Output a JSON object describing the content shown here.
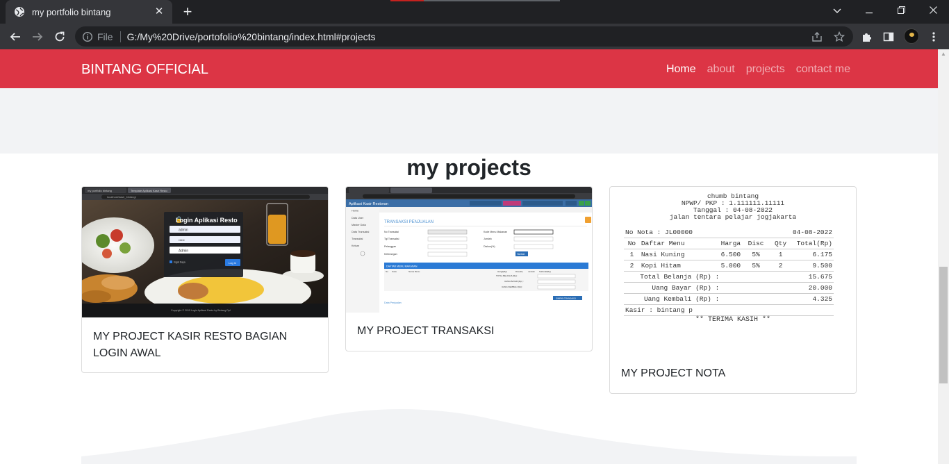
{
  "browser": {
    "tab_title": "my portfolio bintang",
    "omnibox_scheme": "File",
    "omnibox_url": "G:/My%20Drive/portofolio%20bintang/index.html#projects"
  },
  "navbar": {
    "brand": "BINTANG OFFICIAL",
    "links": [
      {
        "label": "Home",
        "active": true
      },
      {
        "label": "about",
        "active": false
      },
      {
        "label": "projects",
        "active": false
      },
      {
        "label": "contact me",
        "active": false
      }
    ],
    "color": "#dc3545"
  },
  "projects": {
    "title": "my projects",
    "cards": [
      {
        "caption": "MY PROJECT KASIR RESTO BAGIAN LOGIN AWAL"
      },
      {
        "caption": "MY PROJECT TRANSAKSI"
      },
      {
        "caption": "MY PROJECT NOTA"
      }
    ]
  },
  "login_screenshot": {
    "tab1": "my portfolio bintang",
    "tab2": "Template Aplikasi Kasir Resto",
    "url": "localhost/kasir_bintang/",
    "heading": "Login Aplikasi Resto",
    "username": "admin",
    "password": "•••••",
    "role": "Admin",
    "remember": "Ingat Saya",
    "login_button": "Log In",
    "footer": "Copyright © 2015 Login Aplikasi Resto by Bintang Dpl"
  },
  "transaction_screenshot": {
    "app_title": "Aplikasi Kasir Restoran",
    "page_heading": "TRANSAKSI PENJUALAN",
    "menu": [
      "Home",
      "Data User",
      "Master Data",
      "Data Transaksi",
      "Transaksi",
      "Keluar"
    ],
    "form_left": [
      "No Transaksi",
      "Tgl Transaksi",
      "Pelanggan",
      "Keterangan"
    ],
    "form_right": [
      "Kode Menu Makanan",
      "Jumlah",
      "Diskon(%)"
    ],
    "table_bar": "DAFTAR MENU MAKANAN",
    "table_headers": [
      "No",
      "Kode",
      "Nama Menu",
      "Harga(Rp)",
      "Disc(%)",
      "Jumlah",
      "Subtotal(Rp)"
    ],
    "totals": [
      "TOTAL BELANJA (Rp) :",
      "UANG BAYAR (Rp) :",
      "UANG KEMBALI (Rp) :"
    ],
    "save_button": "SIMPAN TRANSAKSI",
    "link": "Data Penjualan",
    "add_button": "Tambah",
    "zero": "0"
  },
  "receipt": {
    "shop": "chumb bintang",
    "npwp": "NPWP/ PKP : 1.111111.11111",
    "date_line": "Tanggal : 04-08-2022",
    "address": "jalan tentara pelajar jogjakarta",
    "nota_label": "No Nota : JL00000",
    "nota_date": "04-08-2022",
    "headers": [
      "No",
      "Daftar Menu",
      "Harga",
      "Disc",
      "Qty",
      "Total(Rp)"
    ],
    "rows": [
      [
        "1",
        "Nasi Kuning",
        "6.500",
        "5%",
        "1",
        "6.175"
      ],
      [
        "2",
        "Kopi Hitam",
        "5.000",
        "5%",
        "2",
        "9.500"
      ]
    ],
    "total_label": "Total Belanja (Rp) :",
    "total_value": "15.675",
    "paid_label": "Uang Bayar (Rp) :",
    "paid_value": "20.000",
    "change_label": "Uang Kembali (Rp) :",
    "change_value": "4.325",
    "cashier": "Kasir : bintang p",
    "thanks": "** TERIMA KASIH **"
  }
}
